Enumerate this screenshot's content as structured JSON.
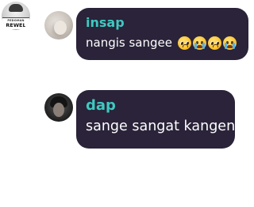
{
  "server": {
    "icon_name": "server-icon",
    "logo_small_text": "PEDOMAN",
    "logo_big_text": "REWEL"
  },
  "messages": [
    {
      "author": "insap",
      "text": "nangis sangee",
      "emojis": [
        "pleading-face-icon",
        "sob-icon",
        "pleading-face-icon",
        "sob-icon"
      ]
    },
    {
      "author": "dap",
      "text": "sange sangat kangen",
      "emojis": []
    }
  ],
  "colors": {
    "background": "#ffffff",
    "bubble": "#2a2339",
    "username": "#3ec9c0",
    "message_text": "#ffffff"
  }
}
